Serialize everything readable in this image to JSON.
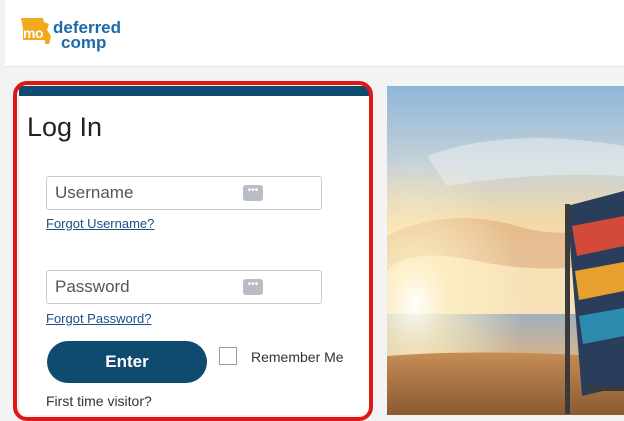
{
  "header": {
    "logo_mo": "mo",
    "logo_line1": "deferred",
    "logo_line2": "comp"
  },
  "login": {
    "title": "Log In",
    "username_placeholder": "Username",
    "forgot_username": "Forgot Username?",
    "password_placeholder": "Password",
    "forgot_password": "Forgot Password?",
    "enter_label": "Enter",
    "remember_label": "Remember Me",
    "first_time": "First time visitor?"
  },
  "icons": {
    "logo": "missouri-state-icon",
    "password_manager": "key-dots-icon"
  },
  "colors": {
    "brand_blue": "#0f4b6e",
    "link_blue": "#1a4f88",
    "highlight_red": "#e01717",
    "logo_orange": "#f2a91c"
  }
}
